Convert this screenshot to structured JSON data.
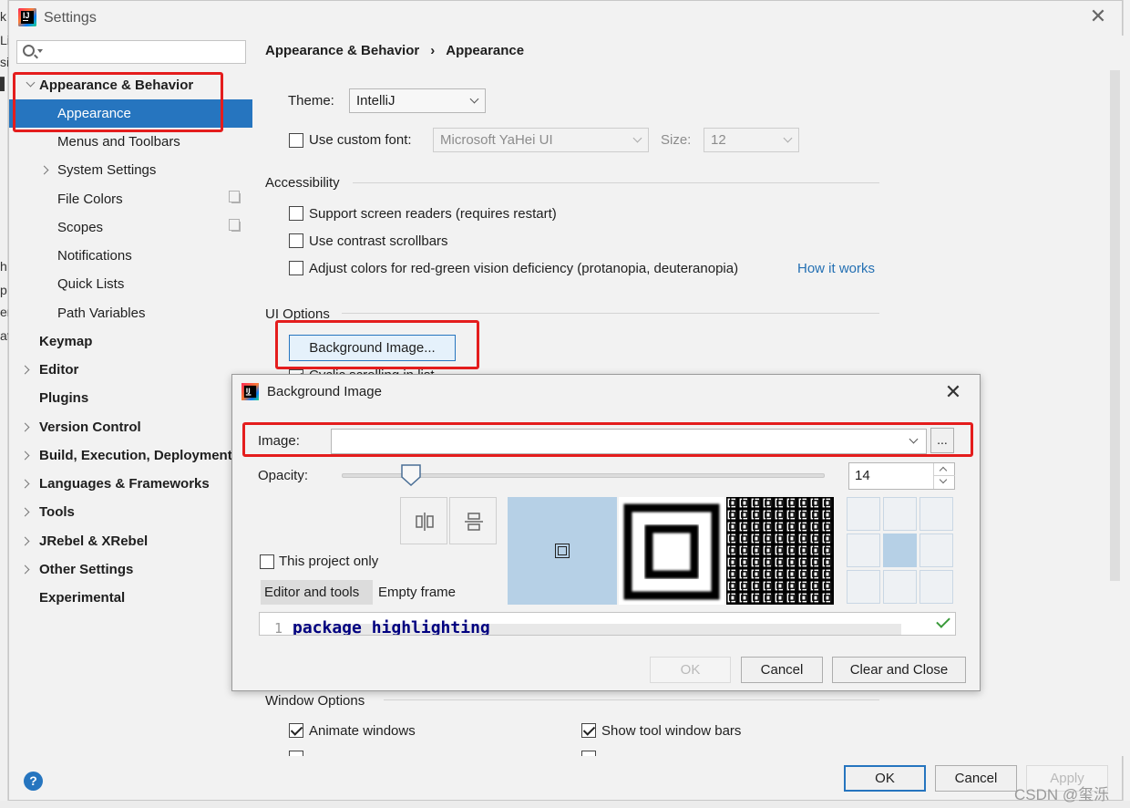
{
  "window": {
    "title": "Settings",
    "close_glyph": "✕"
  },
  "background_app": {
    "letters": [
      "k",
      "Li",
      "si",
      "▌",
      "",
      "h",
      "p",
      "er",
      "at"
    ]
  },
  "sidebar": {
    "search_placeholder": "",
    "items": [
      {
        "label": "Appearance & Behavior",
        "bold": true,
        "expanded": true
      },
      {
        "label": "Appearance",
        "selected": true
      },
      {
        "label": "Menus and Toolbars"
      },
      {
        "label": "System Settings"
      },
      {
        "label": "File Colors"
      },
      {
        "label": "Scopes"
      },
      {
        "label": "Notifications"
      },
      {
        "label": "Quick Lists"
      },
      {
        "label": "Path Variables"
      },
      {
        "label": "Keymap",
        "bold": true
      },
      {
        "label": "Editor",
        "bold": true
      },
      {
        "label": "Plugins",
        "bold": true
      },
      {
        "label": "Version Control",
        "bold": true
      },
      {
        "label": "Build, Execution, Deployment",
        "bold": true
      },
      {
        "label": "Languages & Frameworks",
        "bold": true
      },
      {
        "label": "Tools",
        "bold": true
      },
      {
        "label": "JRebel & XRebel",
        "bold": true
      },
      {
        "label": "Other Settings",
        "bold": true
      },
      {
        "label": "Experimental",
        "bold": true
      }
    ]
  },
  "breadcrumb": {
    "part1": "Appearance & Behavior",
    "separator": "›",
    "part2": "Appearance"
  },
  "appearance": {
    "theme_label": "Theme:",
    "theme_value": "IntelliJ",
    "custom_font_label": "Use custom font:",
    "custom_font_checked": false,
    "font_value": "Microsoft YaHei UI",
    "size_label": "Size:",
    "size_value": "12",
    "accessibility_header": "Accessibility",
    "screen_readers_label": "Support screen readers (requires restart)",
    "contrast_scrollbars_label": "Use contrast scrollbars",
    "adjust_colors_label": "Adjust colors for red-green vision deficiency (protanopia, deuteranopia)",
    "how_it_works_link": "How it works",
    "ui_options_header": "UI Options",
    "background_image_button": "Background Image...",
    "hidden_option_label": "Cyclic scrolling in list",
    "window_options_header": "Window Options",
    "animate_windows_label": "Animate windows",
    "show_tool_window_bars_label": "Show tool window bars"
  },
  "footer": {
    "help_glyph": "?",
    "ok_label": "OK",
    "cancel_label": "Cancel",
    "apply_label": "Apply"
  },
  "dialog": {
    "title": "Background Image",
    "close_glyph": "✕",
    "image_label": "Image:",
    "image_value": "",
    "browse_label": "...",
    "opacity_label": "Opacity:",
    "opacity_value": "14",
    "opacity_fraction": 0.14,
    "this_project_only_label": "This project only",
    "tab_editor": "Editor and tools",
    "tab_empty_frame": "Empty frame",
    "code_line_number": "1",
    "code_text": "package highlighting",
    "ok_label": "OK",
    "cancel_label": "Cancel",
    "clear_close_label": "Clear and Close"
  },
  "watermark": "CSDN @玺泺",
  "colors": {
    "selection": "#2675bf",
    "link": "#2470b3",
    "highlight_box": "#e41d1d",
    "preview_blue": "#b6d0e6"
  }
}
